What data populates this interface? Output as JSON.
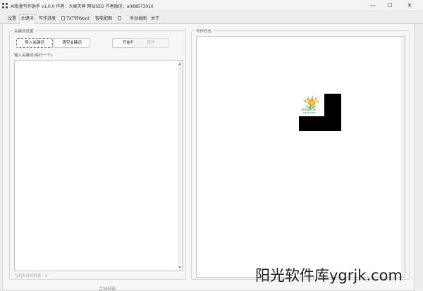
{
  "window": {
    "title": "AI批量写作助手 v1.0.0 作者：大娱天尊 网站SEO 作者微信：a088673910",
    "minimize_glyph": "—",
    "maximize_glyph": "☐",
    "close_glyph": "✕"
  },
  "tabs": [
    {
      "label": "设置",
      "active": false
    },
    {
      "label": "关键词",
      "active": true
    },
    {
      "label": "写作进度",
      "active": false
    },
    {
      "label": "TXT转Word",
      "active": false
    },
    {
      "label": "智能配图",
      "active": false
    },
    {
      "label": "",
      "active": false
    },
    {
      "label": "手动插图",
      "active": false
    },
    {
      "label": "关于",
      "active": false
    }
  ],
  "keyword_settings": {
    "group_title": "关键词设置",
    "buttons": {
      "import": "导入关键词",
      "clear": "清空关键词",
      "start": "开始写作",
      "pause": "暂停"
    },
    "input_label": "输入关键词(每行一个):",
    "keywords_text": "",
    "count_label": "当前关键词数量：0"
  },
  "write_log": {
    "group_title": "写作日志",
    "log_text": ""
  },
  "logo": {
    "line1": "阳光软件库",
    "line2": "ygrjk.com"
  },
  "watermark": "阳光软件库ygrjk.com",
  "behind_text": "合轴纸输"
}
